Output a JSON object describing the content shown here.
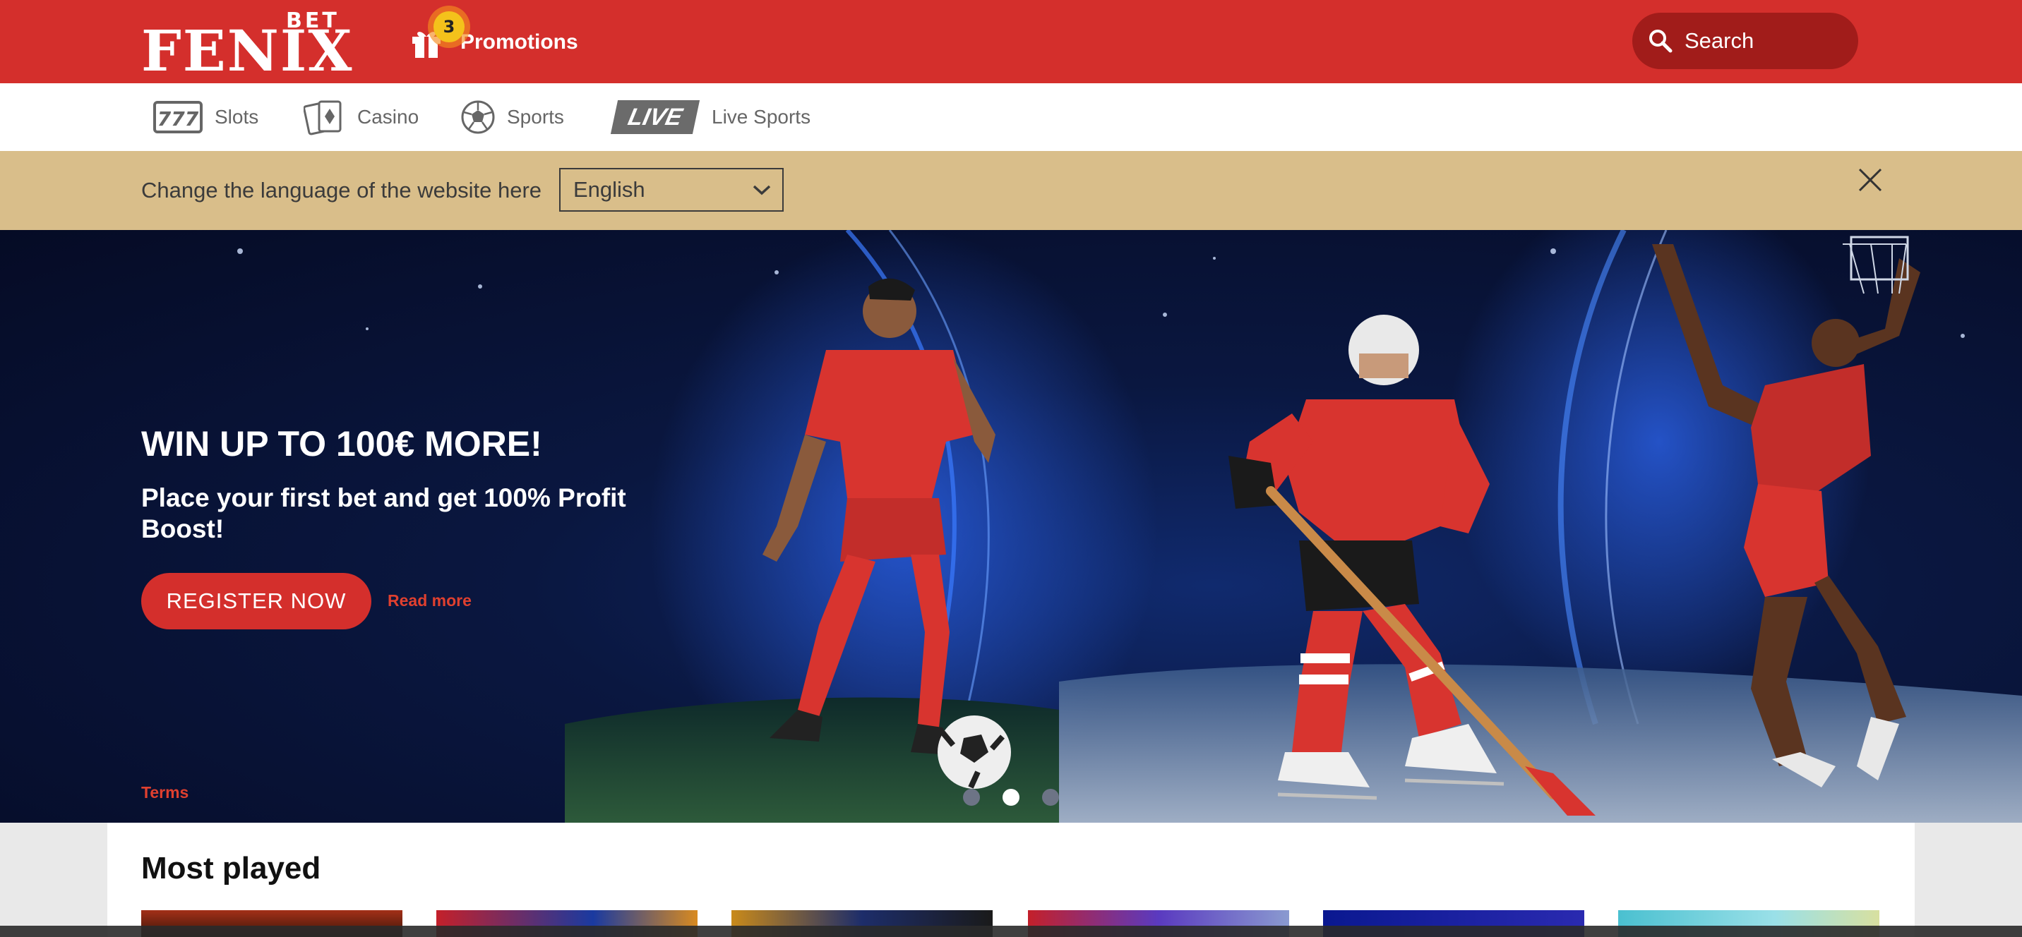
{
  "header": {
    "logo_top": "BET",
    "logo_main": "FENIX",
    "promotions_label": "Promotions",
    "promotions_badge": "3",
    "search_placeholder": "Search"
  },
  "nav": {
    "items": [
      {
        "label": "Slots",
        "icon": "slots-777-icon"
      },
      {
        "label": "Casino",
        "icon": "cards-icon"
      },
      {
        "label": "Sports",
        "icon": "soccer-ball-icon"
      },
      {
        "label": "Live Sports",
        "icon": "live-tag-icon",
        "tag": "LIVE"
      }
    ]
  },
  "language_bar": {
    "text": "Change the language of the website here",
    "selected": "English"
  },
  "hero": {
    "title": "WIN UP TO 100€ MORE!",
    "subtitle": "Place your first bet and get 100% Profit Boost!",
    "cta": "REGISTER NOW",
    "read_more": "Read more",
    "terms": "Terms",
    "slides": 3,
    "active_slide": 2
  },
  "most_played": {
    "title": "Most played"
  },
  "colors": {
    "brand_red": "#d42f2c",
    "search_bg": "#a11c1a",
    "language_bar_bg": "#d9be8a",
    "hero_bg": "#0a1740",
    "link_red": "#e0402f"
  }
}
